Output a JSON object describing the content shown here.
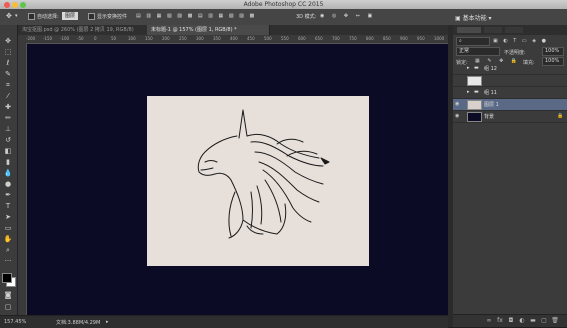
{
  "app": {
    "title": "Adobe Photoshop CC 2015"
  },
  "options_bar": {
    "auto_select_label": "自动选择:",
    "auto_select_value": "图层",
    "show_transform_label": "显示变换控件",
    "mode_label": "3D 模式:"
  },
  "tabs": [
    {
      "label": "淘宝抠图.psd @ 260% (图层 2 拷贝 19, RGB/8)"
    },
    {
      "label": "未标题-1 @ 157% (图层 1, RGB/8) *"
    }
  ],
  "ruler_ticks": [
    "-200",
    "-150",
    "-100",
    "-50",
    "0",
    "50",
    "100",
    "150",
    "200",
    "250",
    "300",
    "350",
    "400",
    "450",
    "500",
    "550",
    "600",
    "650",
    "700",
    "750",
    "800",
    "850",
    "900",
    "950",
    "1000"
  ],
  "tools": [
    "move-icon",
    "marquee-icon",
    "lasso-icon",
    "quick-select-icon",
    "crop-icon",
    "eyedropper-icon",
    "healing-icon",
    "brush-icon",
    "stamp-icon",
    "history-brush-icon",
    "eraser-icon",
    "gradient-icon",
    "blur-icon",
    "dodge-icon",
    "pen-icon",
    "type-icon",
    "path-select-icon",
    "shape-icon",
    "hand-icon",
    "zoom-icon",
    "more-icon"
  ],
  "colors": {
    "foreground": "#000000",
    "background": "#ffffff",
    "canvas_bg": "#0c0b26",
    "selected_layer": "#5a6a86"
  },
  "status": {
    "zoom": "157.45%",
    "doc": "文档:3.88M/4.29M"
  },
  "layers_panel": {
    "blend_mode": "正常",
    "opacity_label": "不透明度:",
    "opacity_value": "100%",
    "lock_label": "锁定:",
    "fill_label": "填充:",
    "fill_value": "100%",
    "layers": [
      {
        "name": "组 12",
        "type": "group",
        "visible": false
      },
      {
        "name": "",
        "type": "thumb-only",
        "visible": false
      },
      {
        "name": "组 11",
        "type": "group",
        "visible": false
      },
      {
        "name": "图层 1",
        "type": "layer",
        "visible": true,
        "selected": true
      },
      {
        "name": "背景",
        "type": "background",
        "visible": true
      }
    ]
  }
}
